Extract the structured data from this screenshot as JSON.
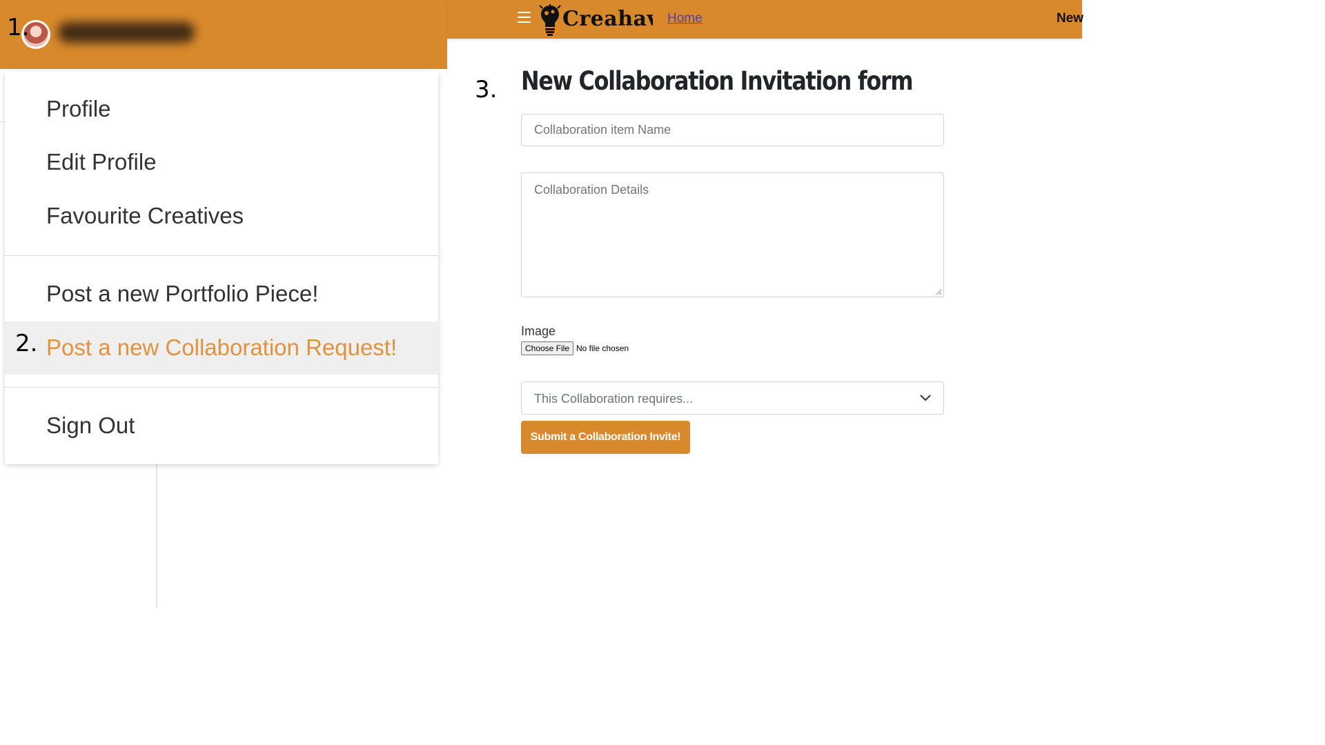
{
  "steps": {
    "one": "1.",
    "two": "2.",
    "three": "3."
  },
  "dropdown": {
    "items": [
      {
        "label": "Profile"
      },
      {
        "label": "Edit Profile"
      },
      {
        "label": "Favourite Creatives"
      },
      {
        "label": "Post a new Portfolio Piece!"
      },
      {
        "label": "Post a new Collaboration Request!"
      },
      {
        "label": "Sign Out"
      }
    ]
  },
  "navbar": {
    "brand": "Creahaver",
    "home_link": "Home",
    "new_link": "New"
  },
  "form": {
    "title": "New Collaboration Invitation form",
    "name_placeholder": "Collaboration item Name",
    "details_placeholder": "Collaboration Details",
    "image_label": "Image",
    "file_button": "Choose File",
    "file_status": "No file chosen",
    "select_placeholder": "This Collaboration requires...",
    "submit_label": "Submit a Collaboration Invite!"
  },
  "colors": {
    "brand": "#d8892b",
    "active_item": "#e0923f"
  },
  "icons": {
    "menu": "hamburger-icon",
    "logo": "creahaver-logo-icon",
    "select": "chevron-down-icon"
  }
}
